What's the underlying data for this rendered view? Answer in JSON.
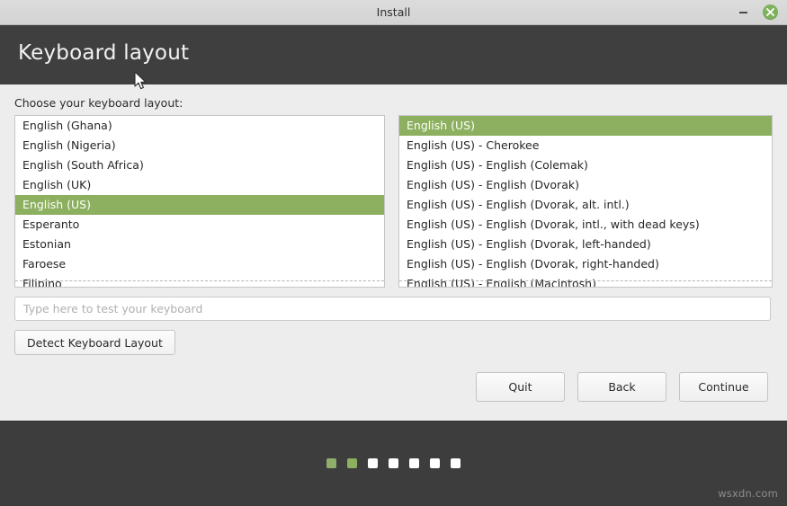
{
  "window": {
    "title": "Install",
    "minimize_label": "–",
    "close_label": "×"
  },
  "header": {
    "title": "Keyboard layout"
  },
  "content": {
    "prompt": "Choose your keyboard layout:",
    "layout_list": {
      "items": [
        "English (Ghana)",
        "English (Nigeria)",
        "English (South Africa)",
        "English (UK)",
        "English (US)",
        "Esperanto",
        "Estonian",
        "Faroese",
        "Filipino"
      ],
      "selected": "English (US)",
      "selected_index": 4
    },
    "variant_list": {
      "items": [
        "English (US)",
        "English (US) - Cherokee",
        "English (US) - English (Colemak)",
        "English (US) - English (Dvorak)",
        "English (US) - English (Dvorak, alt. intl.)",
        "English (US) - English (Dvorak, intl., with dead keys)",
        "English (US) - English (Dvorak, left-handed)",
        "English (US) - English (Dvorak, right-handed)",
        "English (US) - English (Macintosh)"
      ],
      "selected": "English (US)",
      "selected_index": 0
    },
    "test_field": {
      "value": "",
      "placeholder": "Type here to test your keyboard"
    },
    "detect_button": "Detect Keyboard Layout"
  },
  "nav": {
    "quit": "Quit",
    "back": "Back",
    "continue": "Continue"
  },
  "footer": {
    "steps_total": 7,
    "steps_completed": 2,
    "current_step": 2,
    "watermark": "wsxdn.com"
  },
  "colors": {
    "accent_green": "#8cb05f",
    "header_dark": "#3f3f3f",
    "footer_dark": "#3d3d3d",
    "content_bg": "#ededed",
    "titlebar_bg": "#d6d6d6",
    "close_green": "#7fb25c"
  }
}
